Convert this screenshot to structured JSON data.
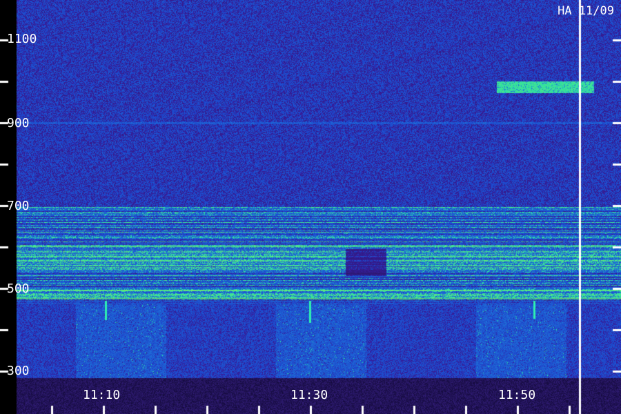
{
  "header": {
    "title": "HA 11/09"
  },
  "spectrogram": {
    "colors": {
      "background": "#1a1a66",
      "noise": "#3a30c8",
      "band_mid": "#2e7bd6",
      "band_high": "#2ff0b0",
      "band_peak": "#88ff66",
      "frame": "#000000",
      "ticks": "#ffffff",
      "cursor": "#ffffff"
    },
    "y_axis": {
      "labels": [
        "1100",
        "900",
        "700",
        "500",
        "300"
      ],
      "values": [
        1100,
        1000,
        900,
        800,
        700,
        600,
        500,
        400,
        300
      ],
      "range": [
        280,
        1260
      ]
    },
    "x_axis": {
      "labels": [
        "11:10",
        "11:30",
        "11:50"
      ],
      "range_minutes": [
        1,
        60
      ]
    }
  }
}
